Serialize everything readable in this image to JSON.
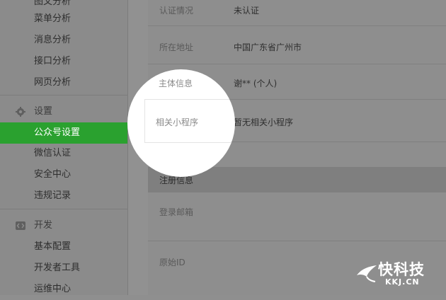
{
  "sidebar": {
    "partial_top_label": "图文分析",
    "analysis_items": [
      {
        "label": "菜单分析"
      },
      {
        "label": "消息分析"
      },
      {
        "label": "接口分析"
      },
      {
        "label": "网页分析"
      }
    ],
    "settings_header": {
      "label": "设置",
      "icon": "gear-icon"
    },
    "settings_items": [
      {
        "label": "公众号设置",
        "active": true
      },
      {
        "label": "微信认证"
      },
      {
        "label": "安全中心"
      },
      {
        "label": "违规记录"
      }
    ],
    "dev_header": {
      "label": "开发",
      "icon": "code-icon"
    },
    "dev_items": [
      {
        "label": "基本配置"
      },
      {
        "label": "开发者工具"
      },
      {
        "label": "运维中心"
      }
    ]
  },
  "account_info": {
    "rows": [
      {
        "label": "认证情况",
        "value": "未认证"
      },
      {
        "label": "所在地址",
        "value": "中国广东省广州市"
      },
      {
        "label": "主体信息",
        "value": "谢** (个人)"
      },
      {
        "label": "相关小程序",
        "value": "暂无相关小程序"
      }
    ]
  },
  "registration": {
    "section_title": "注册信息",
    "rows": [
      {
        "label": "登录邮箱",
        "value": ""
      },
      {
        "label": "原始ID",
        "value": ""
      }
    ]
  },
  "watermark": {
    "brand": "快科技",
    "url": "KKJ.CN"
  },
  "colors": {
    "active_green": "#2aa12f",
    "overlay_gray": "#8f8f8f",
    "spotlight_white": "#ffffff"
  }
}
